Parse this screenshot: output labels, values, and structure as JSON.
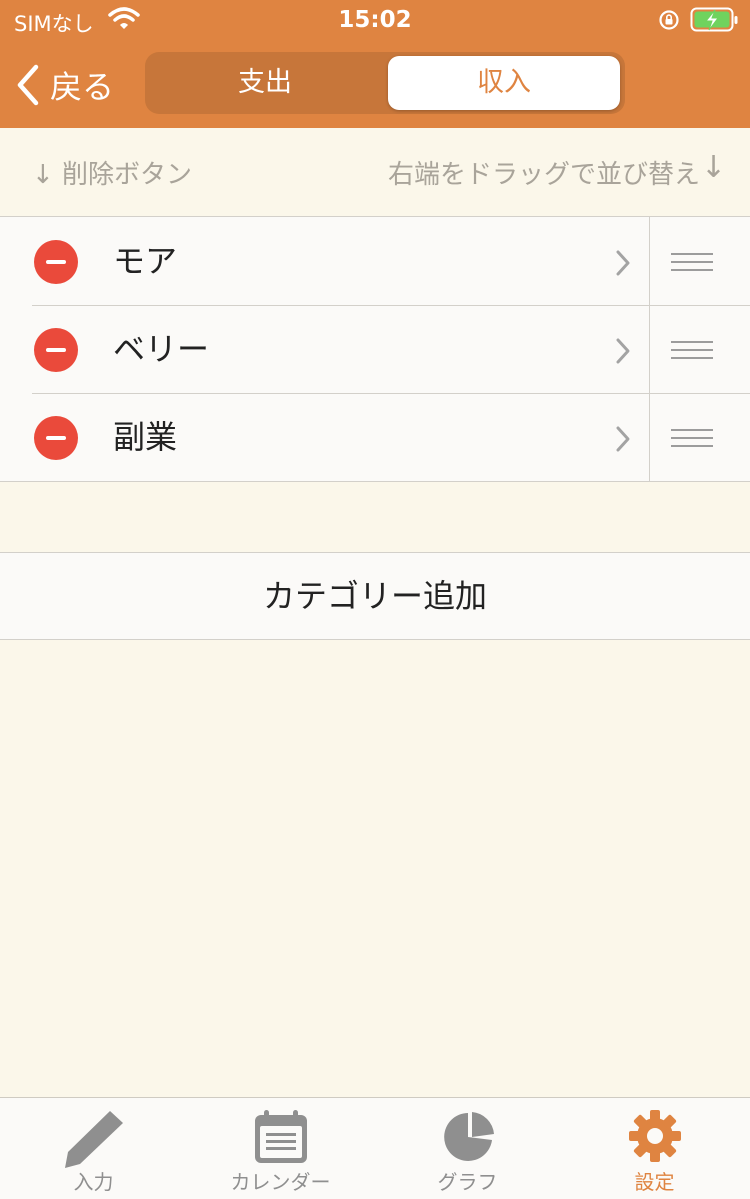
{
  "status_bar": {
    "carrier": "SIMなし",
    "time": "15:02"
  },
  "nav": {
    "back_label": "戻る"
  },
  "segments": {
    "expense": "支出",
    "income": "収入",
    "selected": "income"
  },
  "hint": {
    "left": "↓ 削除ボタン",
    "right": "右端をドラッグで並び替え",
    "right_arrow": "↓"
  },
  "categories": [
    {
      "label": "モア"
    },
    {
      "label": "ベリー"
    },
    {
      "label": "副業"
    }
  ],
  "add_label": "カテゴリー追加",
  "tabs": [
    {
      "label": "入力",
      "icon": "pencil-icon"
    },
    {
      "label": "カレンダー",
      "icon": "calendar-icon"
    },
    {
      "label": "グラフ",
      "icon": "pie-chart-icon"
    },
    {
      "label": "設定",
      "icon": "gear-icon",
      "active": true
    }
  ],
  "colors": {
    "accent": "#df8441",
    "delete": "#ea4a3b",
    "background": "#fbf7ea"
  }
}
